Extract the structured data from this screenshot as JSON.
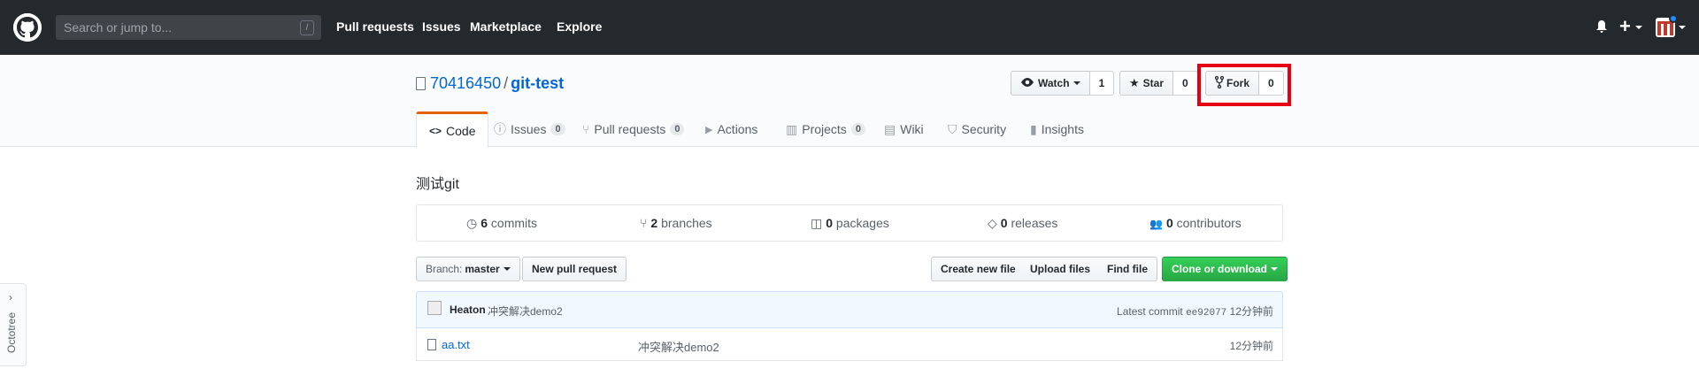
{
  "header": {
    "search_placeholder": "Search or jump to...",
    "search_hotkey": "/",
    "nav": [
      "Pull requests",
      "Issues",
      "Marketplace",
      "Explore"
    ],
    "new_menu_symbol": "+"
  },
  "repo": {
    "owner": "70416450",
    "separator": "/",
    "name": "git-test",
    "watch_label": "Watch",
    "watch_count": "1",
    "star_label": "Star",
    "star_count": "0",
    "fork_label": "Fork",
    "fork_count": "0"
  },
  "tabs": [
    {
      "label": "Code",
      "icon": "code-icon",
      "glyph": "<>"
    },
    {
      "label": "Issues",
      "icon": "issue-icon",
      "glyph": "ⓘ",
      "count": "0"
    },
    {
      "label": "Pull requests",
      "icon": "pull-request-icon",
      "glyph": "⑂",
      "count": "0"
    },
    {
      "label": "Actions",
      "icon": "play-icon",
      "glyph": "▶"
    },
    {
      "label": "Projects",
      "icon": "project-icon",
      "glyph": "▥",
      "count": "0"
    },
    {
      "label": "Wiki",
      "icon": "book-icon",
      "glyph": "▤"
    },
    {
      "label": "Security",
      "icon": "shield-icon",
      "glyph": "⛉"
    },
    {
      "label": "Insights",
      "icon": "graph-icon",
      "glyph": "▮"
    }
  ],
  "description": "测试git",
  "summary": [
    {
      "count": "6",
      "label": "commits",
      "icon": "history-icon",
      "glyph": "◷"
    },
    {
      "count": "2",
      "label": "branches",
      "icon": "branch-icon",
      "glyph": "⑂"
    },
    {
      "count": "0",
      "label": "packages",
      "icon": "package-icon",
      "glyph": "◫"
    },
    {
      "count": "0",
      "label": "releases",
      "icon": "tag-icon",
      "glyph": "◇"
    },
    {
      "count": "0",
      "label": "contributors",
      "icon": "people-icon",
      "glyph": "👥"
    }
  ],
  "toolbar": {
    "branch_prefix": "Branch:",
    "branch_name": "master",
    "new_pr": "New pull request",
    "create_file": "Create new file",
    "upload_files": "Upload files",
    "find_file": "Find file",
    "clone": "Clone or download"
  },
  "commit": {
    "author": "Heaton",
    "message": "冲突解决demo2",
    "latest_label": "Latest commit",
    "sha": "ee92077",
    "age": "12分钟前"
  },
  "files": [
    {
      "name": "aa.txt",
      "message": "冲突解决demo2",
      "age": "12分钟前"
    }
  ],
  "octotree": {
    "label": "Octotree",
    "arrow": "›"
  },
  "colors": {
    "header_bg": "#24292e",
    "link": "#0366d6",
    "tab_accent": "#e36209",
    "clone_green": "#28a745",
    "highlight": "#e60012"
  }
}
